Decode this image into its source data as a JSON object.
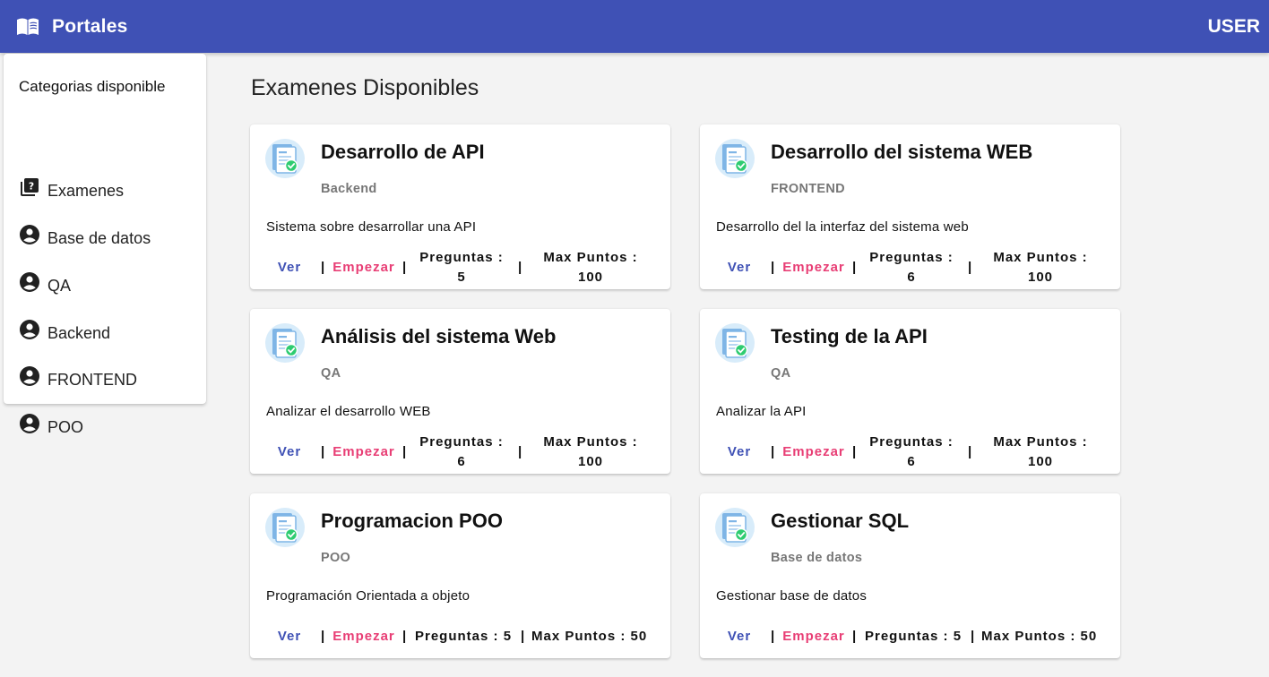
{
  "app": {
    "title": "Portales",
    "user_label": "USER"
  },
  "sidebar": {
    "header": "Categorias disponible",
    "items": [
      {
        "label": "Examenes",
        "icon": "quiz-icon"
      },
      {
        "label": "Base de datos",
        "icon": "account-circle-icon"
      },
      {
        "label": "QA",
        "icon": "account-circle-icon"
      },
      {
        "label": "Backend",
        "icon": "account-circle-icon"
      },
      {
        "label": "FRONTEND",
        "icon": "account-circle-icon"
      },
      {
        "label": "POO",
        "icon": "account-circle-icon"
      }
    ]
  },
  "main": {
    "title": "Examenes Disponibles",
    "cards": [
      {
        "title": "Desarrollo de API",
        "category": "Backend",
        "description": "Sistema sobre desarrollar una API",
        "view_label": "Ver",
        "start_label": "Empezar",
        "questions_label": "Preguntas :",
        "questions": "5",
        "points_label": "Max Puntos :",
        "points": "100"
      },
      {
        "title": "Desarrollo del sistema WEB",
        "category": "FRONTEND",
        "description": "Desarrollo del la interfaz del sistema web",
        "view_label": "Ver",
        "start_label": "Empezar",
        "questions_label": "Preguntas :",
        "questions": "6",
        "points_label": "Max Puntos :",
        "points": "100"
      },
      {
        "title": "Análisis del sistema Web",
        "category": "QA",
        "description": "Analizar el desarrollo WEB",
        "view_label": "Ver",
        "start_label": "Empezar",
        "questions_label": "Preguntas :",
        "questions": "6",
        "points_label": "Max Puntos :",
        "points": "100"
      },
      {
        "title": "Testing de la API",
        "category": "QA",
        "description": "Analizar la API",
        "view_label": "Ver",
        "start_label": "Empezar",
        "questions_label": "Preguntas :",
        "questions": "6",
        "points_label": "Max Puntos :",
        "points": "100"
      },
      {
        "title": "Programacion POO",
        "category": "POO",
        "description": "Programación Orientada a objeto",
        "view_label": "Ver",
        "start_label": "Empezar",
        "questions_label": "Preguntas :",
        "questions": "5",
        "points_label": "Max Puntos :",
        "points": "50"
      },
      {
        "title": "Gestionar SQL",
        "category": "Base de datos",
        "description": "Gestionar base de datos",
        "view_label": "Ver",
        "start_label": "Empezar",
        "questions_label": "Preguntas :",
        "questions": "5",
        "points_label": "Max Puntos :",
        "points": "50"
      }
    ]
  },
  "colors": {
    "primary": "#3f51b5",
    "accent": "#e83e75",
    "background": "#f3f3f3"
  }
}
